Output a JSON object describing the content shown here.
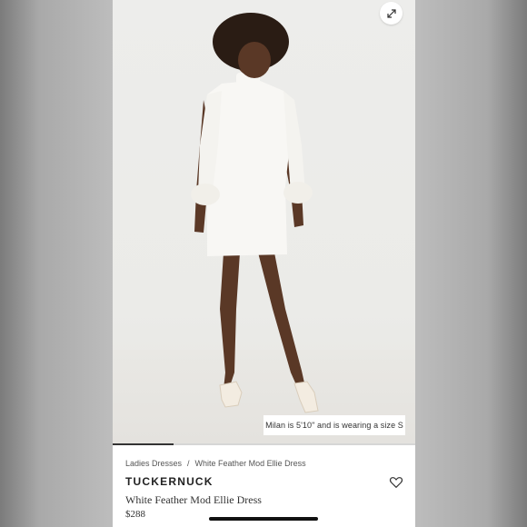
{
  "photo": {
    "caption": "Milan is 5'10\" and is wearing a size S",
    "progress": 0.2
  },
  "breadcrumb": {
    "items": [
      "Ladies Dresses",
      "White Feather Mod Ellie Dress"
    ],
    "separator": "/"
  },
  "product": {
    "brand": "TUCKERNUCK",
    "title": "White Feather Mod Ellie Dress",
    "price": "$288"
  },
  "icons": {
    "expand": "expand-icon",
    "favorite": "heart-icon"
  }
}
